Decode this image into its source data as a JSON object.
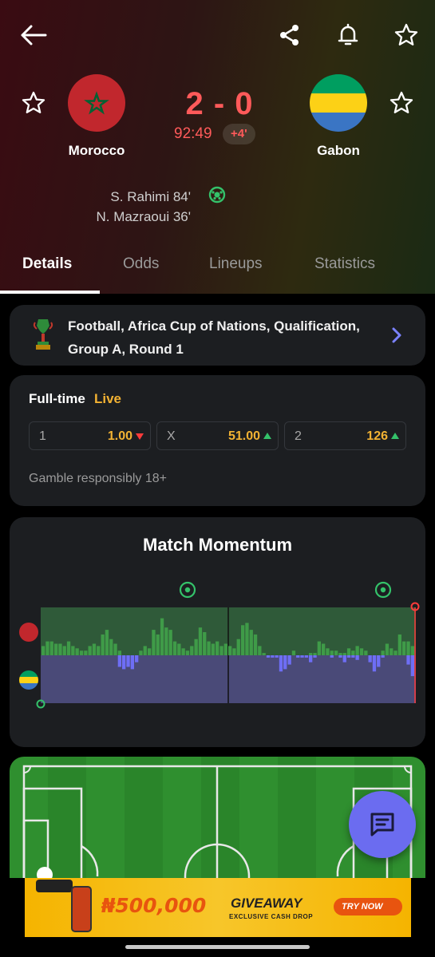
{
  "colors": {
    "score_red": "#ff5a5a",
    "odds_gold": "#f2b233",
    "accent_purple": "#6b6cf0",
    "home_bar": "#3f9b48",
    "away_bar": "#6e6ef5"
  },
  "match": {
    "home_team": "Morocco",
    "away_team": "Gabon",
    "score": "2 - 0",
    "clock": "92:49",
    "added_time": "+4'",
    "scorers": [
      "S. Rahimi 84'",
      "N. Mazraoui 36'"
    ]
  },
  "tabs": [
    {
      "label": "Details",
      "active": true
    },
    {
      "label": "Odds",
      "active": false
    },
    {
      "label": "Lineups",
      "active": false
    },
    {
      "label": "Statistics",
      "active": false
    }
  ],
  "competition": {
    "line1": "Football, Africa Cup of Nations, Qualification,",
    "line2": "Group A, Round 1"
  },
  "odds": {
    "title": "Full-time",
    "status": "Live",
    "items": [
      {
        "key": "1",
        "value": "1.00",
        "trend": "down"
      },
      {
        "key": "X",
        "value": "51.00",
        "trend": "up"
      },
      {
        "key": "2",
        "value": "126",
        "trend": "up"
      }
    ],
    "disclaimer": "Gamble responsibly 18+"
  },
  "momentum": {
    "title": "Match Momentum",
    "home_bars": [
      0.2,
      0.3,
      0.3,
      0.25,
      0.25,
      0.2,
      0.3,
      0.2,
      0.15,
      0.1,
      0.1,
      0.2,
      0.25,
      0.2,
      0.45,
      0.55,
      0.35,
      0.25,
      0.1,
      0,
      0,
      0,
      0,
      0.1,
      0.2,
      0.15,
      0.55,
      0.45,
      0.8,
      0.6,
      0.55,
      0.3,
      0.25,
      0.15,
      0.1,
      0.2,
      0.35,
      0.6,
      0.5,
      0.3,
      0.25,
      0.3,
      0.2,
      0.25,
      0.2,
      0.15,
      0.35,
      0.65,
      0.7,
      0.55,
      0.45,
      0.2,
      0.05,
      0,
      0,
      0,
      0,
      0,
      0,
      0.1,
      0,
      0,
      0,
      0.05,
      0.05,
      0.3,
      0.25,
      0.15,
      0.1,
      0.1,
      0.05,
      0.05,
      0.15,
      0.1,
      0.2,
      0.15,
      0.1,
      0,
      0,
      0,
      0.1,
      0.25,
      0.15,
      0.1,
      0.45,
      0.3,
      0.3,
      0.2
    ],
    "away_bars": [
      0,
      0,
      0,
      0,
      0,
      0,
      0,
      0,
      0,
      0,
      0,
      0,
      0,
      0,
      0,
      0,
      0,
      0,
      0.25,
      0.3,
      0.25,
      0.3,
      0.15,
      0,
      0,
      0,
      0,
      0,
      0,
      0,
      0,
      0,
      0,
      0,
      0,
      0,
      0,
      0,
      0,
      0,
      0,
      0,
      0,
      0,
      0,
      0,
      0,
      0,
      0,
      0,
      0,
      0,
      0,
      0.05,
      0.05,
      0.05,
      0.35,
      0.3,
      0.2,
      0,
      0.05,
      0.05,
      0.05,
      0.15,
      0.05,
      0,
      0,
      0,
      0.05,
      0,
      0.05,
      0.15,
      0.05,
      0.05,
      0.1,
      0,
      0,
      0.15,
      0.35,
      0.25,
      0.05,
      0,
      0,
      0,
      0,
      0,
      0.2,
      0.45
    ],
    "goal_minutes_label": "goals"
  },
  "ad": {
    "amount": "₦500,000",
    "headline": "GIVEAWAY",
    "subline": "EXCLUSIVE CASH DROP",
    "cta": "TRY NOW"
  }
}
